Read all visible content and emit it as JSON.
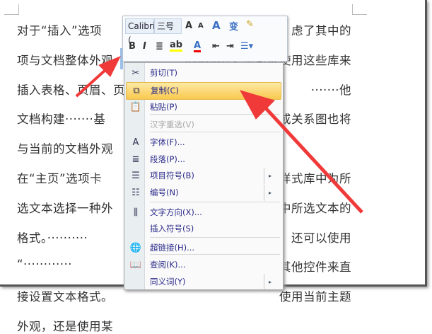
{
  "document": {
    "lines": [
      {
        "left": "对于“插入”选项",
        "right": "虑了其中的"
      },
      {
        "left": "项与文档整体外观",
        "right": "·······的协调性。·您可以使用这些库来"
      },
      {
        "left": "插入表格、页眉、页",
        "right": "·······他"
      },
      {
        "left": "文档构建·······基",
        "right": "或关系图也将"
      },
      {
        "left": "与当前的文档外观",
        "right": ""
      },
      {
        "left": "在“主页”选项卡",
        "right": "样式库中为所"
      },
      {
        "left": "选文本选择一种外",
        "right": "中所选文本的"
      },
      {
        "left": "格式。··········",
        "right": "还可以使用"
      },
      {
        "left": "“············",
        "right": "其他控件来直"
      },
      {
        "left": "接设置文本格式。",
        "right": "使用当前主题"
      },
      {
        "left": "外观，还是使用某",
        "right": ""
      }
    ]
  },
  "mini_toolbar": {
    "font": "Calibri (",
    "size": "三号",
    "bold": "B",
    "italic": "I",
    "grow": "A",
    "shrink": "A",
    "font_color_icon": "A"
  },
  "context_menu": {
    "items": [
      {
        "label": "剪切(T)",
        "icon": "scissors-icon",
        "glyph": "✂"
      },
      {
        "label": "复制(C)",
        "icon": "copy-icon",
        "glyph": "⧉"
      },
      {
        "label": "粘贴(P)",
        "icon": "paste-icon",
        "glyph": "📋"
      },
      {
        "label": "汉字重选(V)",
        "icon": "",
        "glyph": ""
      },
      {
        "label": "字体(F)...",
        "icon": "font-icon",
        "glyph": "A"
      },
      {
        "label": "段落(P)...",
        "icon": "paragraph-icon",
        "glyph": "≣"
      },
      {
        "label": "项目符号(B)",
        "icon": "bullets-icon",
        "glyph": "☰"
      },
      {
        "label": "编号(N)",
        "icon": "numbering-icon",
        "glyph": "☷"
      },
      {
        "label": "文字方向(X)...",
        "icon": "text-direction-icon",
        "glyph": "⫼"
      },
      {
        "label": "插入符号(S)",
        "icon": "",
        "glyph": ""
      },
      {
        "label": "超链接(H)...",
        "icon": "hyperlink-icon",
        "glyph": "🌐"
      },
      {
        "label": "查阅(K)...",
        "icon": "lookup-icon",
        "glyph": "📖"
      },
      {
        "label": "同义词(Y)",
        "icon": "",
        "glyph": ""
      }
    ],
    "submenu_glyph": "▸"
  },
  "colors": {
    "highlight": "#f9c94e",
    "arrow": "#f03a3a"
  }
}
